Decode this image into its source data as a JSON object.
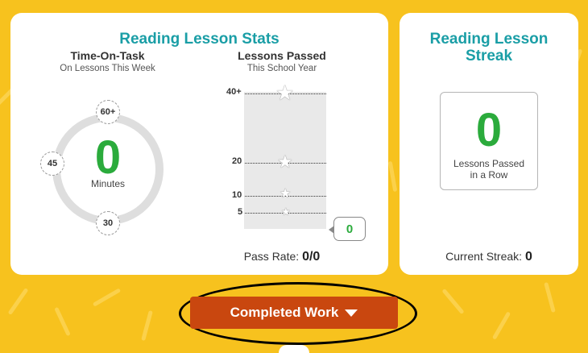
{
  "colors": {
    "background": "#f7c21e",
    "title_teal": "#1a9ea6",
    "zero_green": "#2bab3c",
    "button": "#c9470f"
  },
  "stats_card": {
    "title": "Reading Lesson Stats",
    "time_on_task": {
      "heading": "Time-On-Task",
      "subheading": "On Lessons This Week",
      "value": "0",
      "unit": "Minutes",
      "markers": {
        "top": "60+",
        "left": "45",
        "bottom": "30"
      }
    },
    "lessons_passed": {
      "heading": "Lessons Passed",
      "subheading": "This School Year",
      "ticks": [
        "40+",
        "20",
        "10",
        "5"
      ],
      "count": "0",
      "pass_rate_label": "Pass Rate:",
      "pass_rate_value": "0/0"
    }
  },
  "streak_card": {
    "title_line1": "Reading Lesson",
    "title_line2": "Streak",
    "value": "0",
    "caption_line1": "Lessons Passed",
    "caption_line2": "in a Row",
    "current_label": "Current Streak:",
    "current_value": "0"
  },
  "button": {
    "label": "Completed Work",
    "icon": "caret-down-icon"
  }
}
